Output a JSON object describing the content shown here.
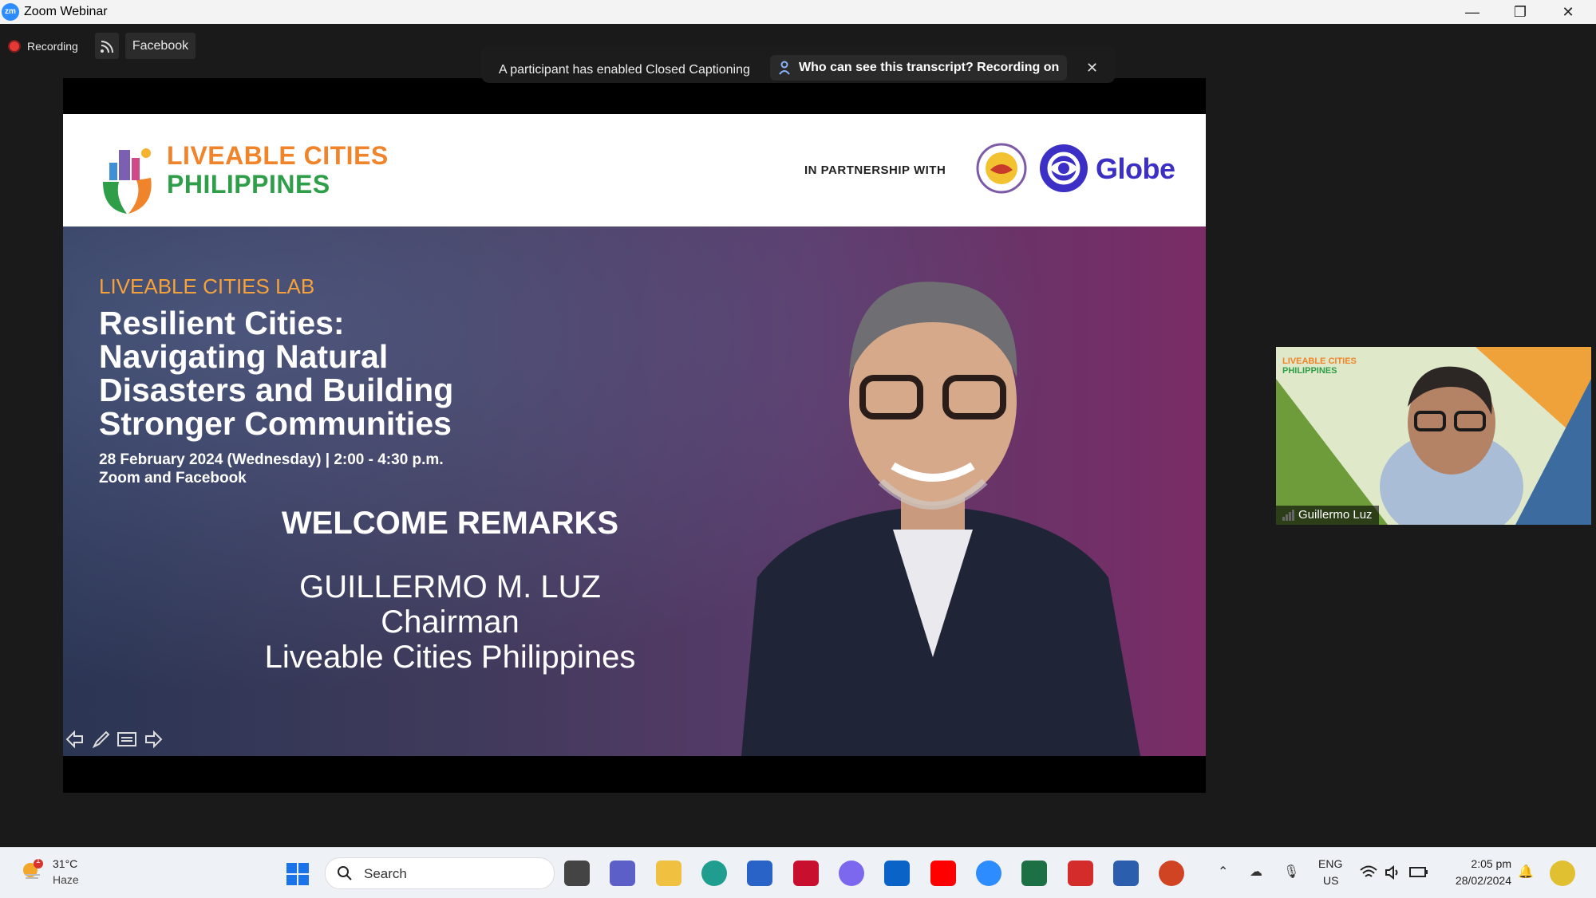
{
  "window": {
    "app_title": "Zoom Webinar"
  },
  "toolbar": {
    "recording_label": "Recording",
    "stream_target": "Facebook"
  },
  "caption_banner": {
    "message": "A participant has enabled Closed Captioning",
    "info_button": "Who can see this transcript? Recording on"
  },
  "slide": {
    "org_line1": "LIVEABLE CITIES",
    "org_line2": "PHILIPPINES",
    "partnership_label": "IN PARTNERSHIP WITH",
    "partner_logo_text": "Globe",
    "series": "LIVEABLE CITIES LAB",
    "headline": [
      "Resilient Cities:",
      "Navigating Natural",
      "Disasters and Building",
      "Stronger Communities"
    ],
    "date_time": "28 February 2024 (Wednesday) | 2:00 - 4:30 p.m.",
    "platforms": "Zoom and Facebook",
    "segment": "WELCOME REMARKS",
    "speaker_name": "GUILLERMO M. LUZ",
    "speaker_role": "Chairman",
    "speaker_org": "Liveable Cities Philippines"
  },
  "video_tile": {
    "participant_name": "Guillermo Luz",
    "bg_logo_line1": "LIVEABLE CITIES",
    "bg_logo_line2": "PHILIPPINES"
  },
  "taskbar": {
    "weather_temp": "31°C",
    "weather_cond": "Haze",
    "weather_badge": "1",
    "search_label": "Search",
    "lang_line1": "ENG",
    "lang_line2": "US",
    "time": "2:05 pm",
    "date": "28/02/2024"
  },
  "colors": {
    "zoom_blue": "#2d8cff",
    "recording_red": "#e53935",
    "lcp_orange": "#f0842a",
    "lcp_green": "#2e9e48",
    "globe_purple": "#3b2fc6",
    "lab_orange": "#f5a23a"
  },
  "icons": [
    "zoom-app-icon",
    "recording-dot-icon",
    "live-stream-icon",
    "person-icon",
    "close-icon",
    "minimize-icon",
    "restore-icon",
    "weather-icon",
    "windows-start-icon",
    "search-icon",
    "signal-bars-icon",
    "wifi-icon",
    "speaker-icon",
    "battery-icon",
    "notification-icon"
  ]
}
